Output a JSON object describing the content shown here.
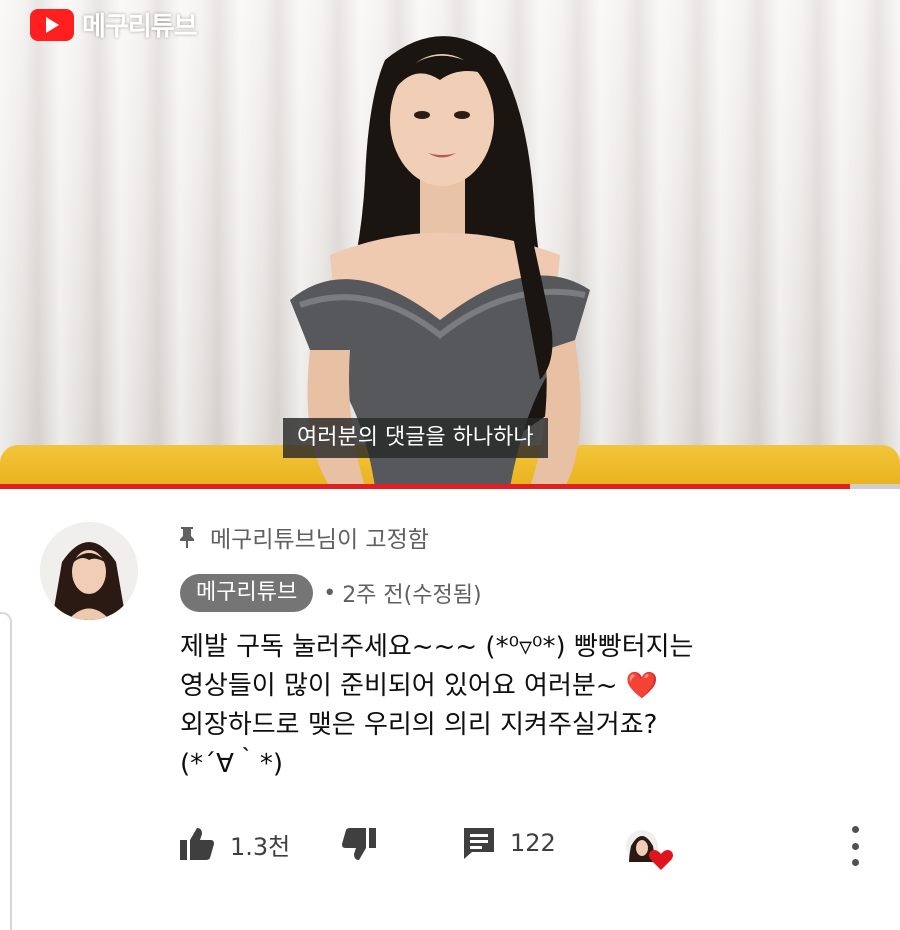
{
  "video": {
    "channel_logo_text": "메구리튜브",
    "subtitle": "여러분의 댓글을 하나하나",
    "progress": 0.944,
    "progress_color": "#e02020"
  },
  "comment": {
    "pinned_by": "메구리튜브님이 고정함",
    "author": "메구리튜브",
    "separator": "•",
    "time": "2주 전(수정됨)",
    "lines": [
      "제발 구독 눌러주세요~~~ (*⁰▿⁰*) 빵빵터지는",
      "영상들이 많이 준비되어 있어요 여러분~",
      "외장하드로 맺은 우리의 의리 지켜주실거죠?",
      "(*´∀｀*)"
    ],
    "heart_emoji": "❤️",
    "likes": "1.3천",
    "replies": "122",
    "icons": {
      "pin": "pin-icon",
      "like": "thumbs-up-icon",
      "dislike": "thumbs-down-icon",
      "reply": "comment-icon",
      "creator_heart": "creator-heart-icon",
      "more": "more-vertical-icon"
    }
  },
  "colors": {
    "brand_red": "#ff1f1f",
    "chip_gray": "#757575",
    "heart_red": "#e0141e"
  }
}
